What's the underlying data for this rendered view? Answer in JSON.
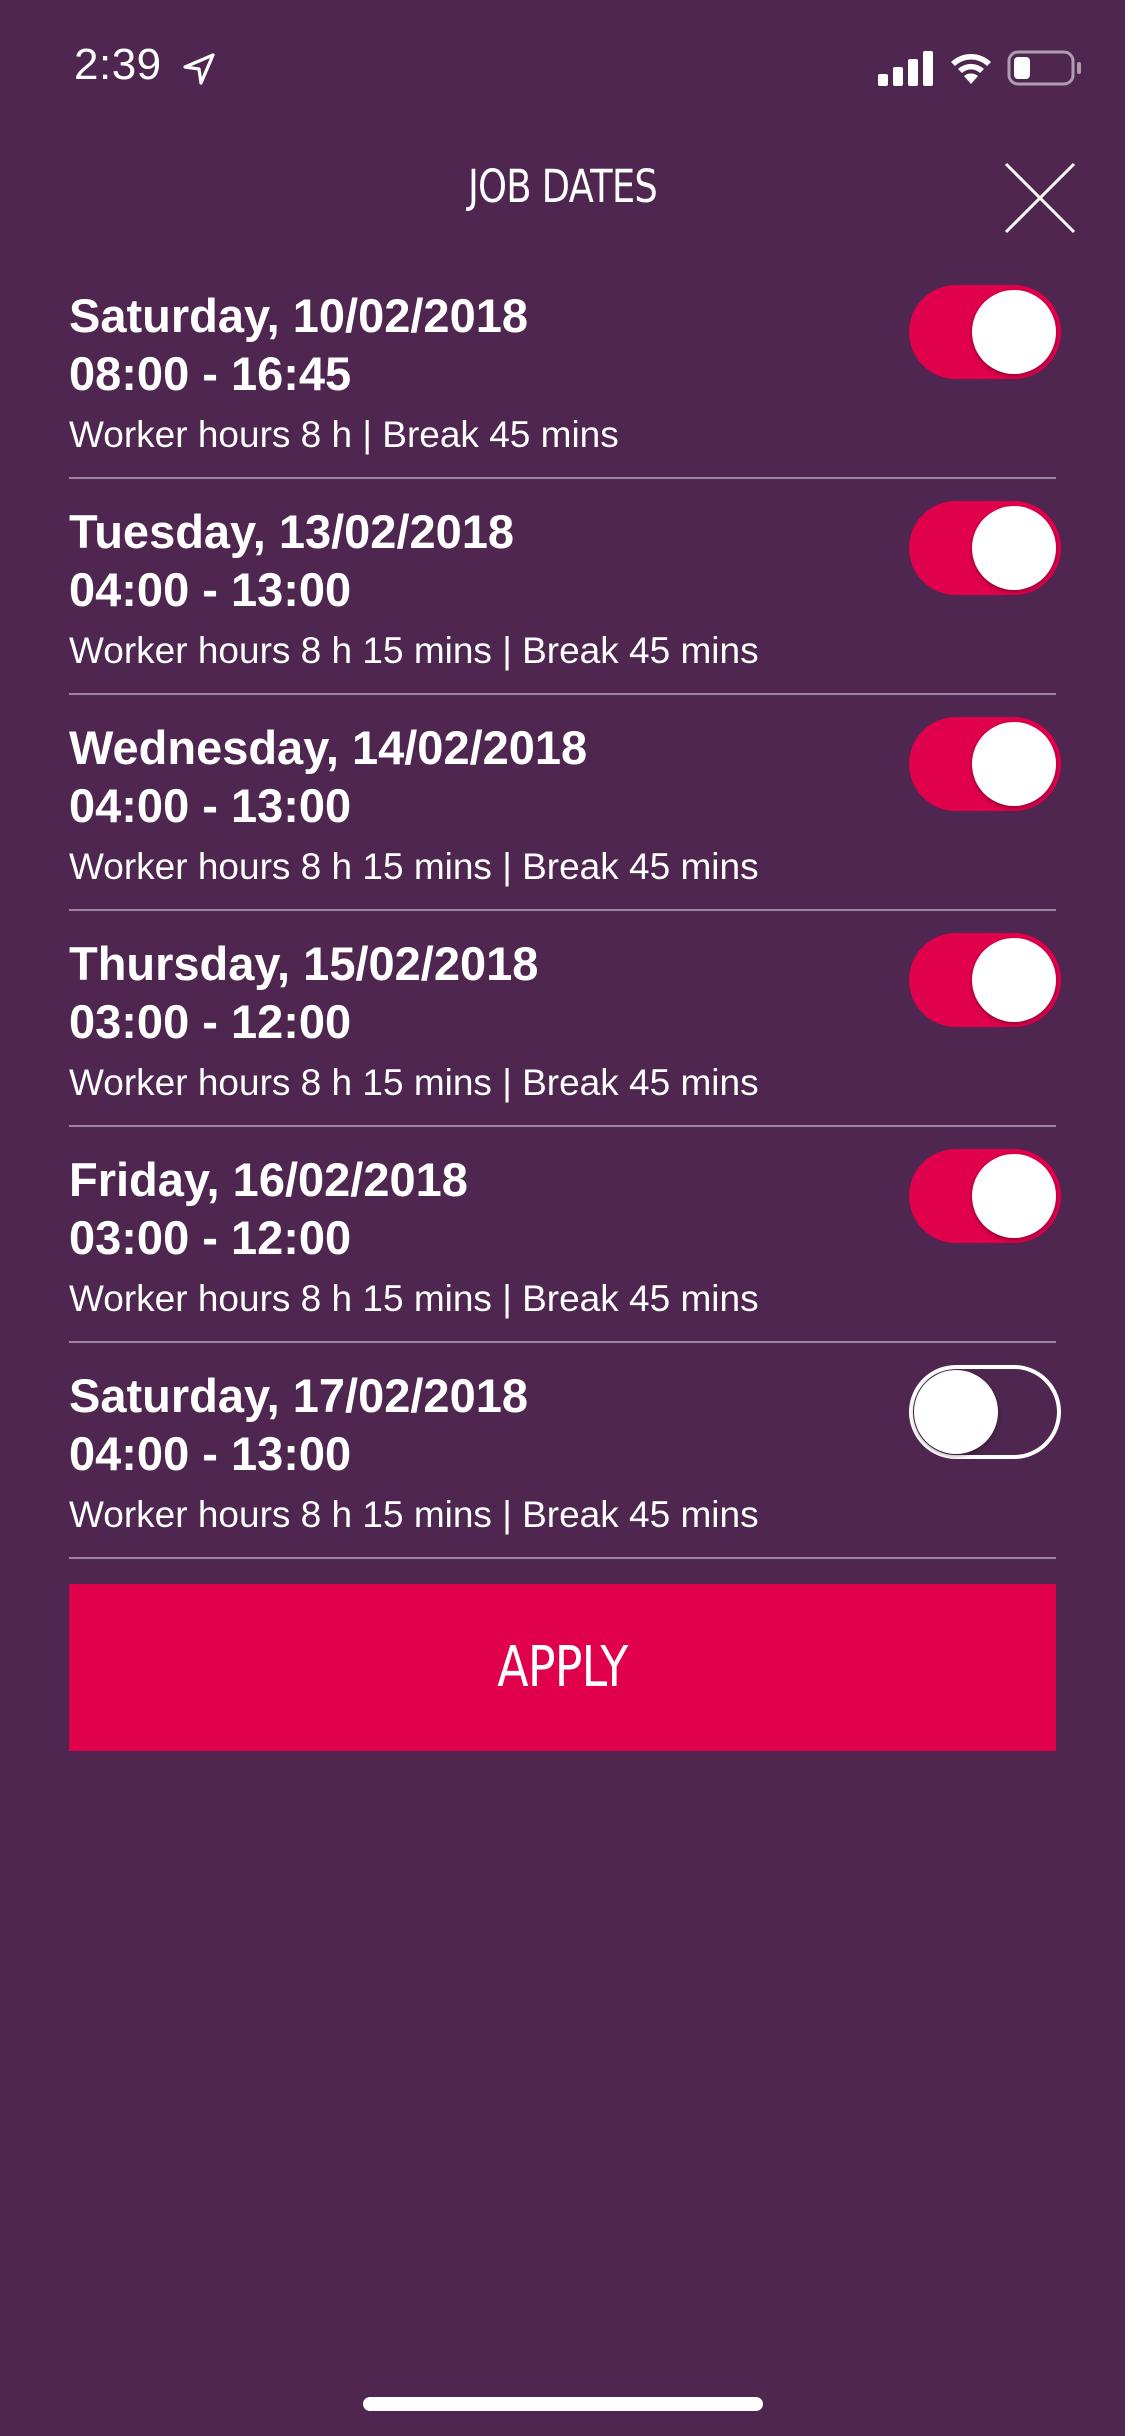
{
  "status_bar": {
    "time": "2:39",
    "location_icon": "location-arrow-icon",
    "signal_icon": "cellular-signal-icon",
    "wifi_icon": "wifi-icon",
    "battery_icon": "battery-icon",
    "battery_level": 0.3
  },
  "header": {
    "title": "JOB DATES",
    "close_icon": "close-icon"
  },
  "dates": [
    {
      "day": "Saturday, 10/02/2018",
      "time": "08:00 - 16:45",
      "hours": "Worker hours 8 h | Break 45 mins",
      "selected": true
    },
    {
      "day": "Tuesday, 13/02/2018",
      "time": "04:00 - 13:00",
      "hours": "Worker hours 8 h 15 mins | Break 45 mins",
      "selected": true
    },
    {
      "day": "Wednesday, 14/02/2018",
      "time": "04:00 - 13:00",
      "hours": "Worker hours 8 h 15 mins | Break 45 mins",
      "selected": true
    },
    {
      "day": "Thursday, 15/02/2018",
      "time": "03:00 - 12:00",
      "hours": "Worker hours 8 h 15 mins | Break 45 mins",
      "selected": true
    },
    {
      "day": "Friday, 16/02/2018",
      "time": "03:00 - 12:00",
      "hours": "Worker hours 8 h 15 mins | Break 45 mins",
      "selected": true
    },
    {
      "day": "Saturday, 17/02/2018",
      "time": "04:00 - 13:00",
      "hours": "Worker hours 8 h 15 mins | Break 45 mins",
      "selected": false
    }
  ],
  "apply_label": "APPLY",
  "colors": {
    "background": "#4e264f",
    "accent": "#e0004b",
    "text": "#ffffff"
  }
}
